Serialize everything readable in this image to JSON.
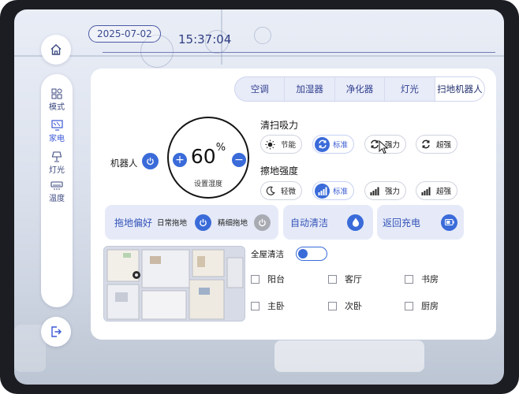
{
  "header": {
    "date": "2025-07-02",
    "time": "15:37:04"
  },
  "sidebar": {
    "home_icon": "home-icon",
    "items": [
      {
        "id": "mode",
        "label": "模式",
        "icon": "grid-icon",
        "active": false
      },
      {
        "id": "appliance",
        "label": "家电",
        "icon": "appliance-icon",
        "active": true
      },
      {
        "id": "light",
        "label": "灯光",
        "icon": "lamp-icon",
        "active": false
      },
      {
        "id": "temperature",
        "label": "温度",
        "icon": "ac-icon",
        "active": false
      }
    ],
    "logout_icon": "logout-icon"
  },
  "tabs": [
    {
      "label": "空调",
      "active": false
    },
    {
      "label": "加湿器",
      "active": false
    },
    {
      "label": "净化器",
      "active": false
    },
    {
      "label": "灯光",
      "active": false
    },
    {
      "label": "扫地机器人",
      "active": true
    }
  ],
  "robot": {
    "label": "机器人",
    "power_on": true
  },
  "dial": {
    "value": "60",
    "unit": "%",
    "label": "设置湿度"
  },
  "suction": {
    "title": "清扫吸力",
    "options": [
      {
        "label": "节能",
        "icon": "sun-icon",
        "active": false
      },
      {
        "label": "标准",
        "icon": "cycle-icon",
        "active": true
      },
      {
        "label": "强力",
        "icon": "cycle-icon",
        "active": false
      },
      {
        "label": "超强",
        "icon": "cycle-icon",
        "active": false
      }
    ]
  },
  "mop": {
    "title": "擦地强度",
    "options": [
      {
        "label": "轻微",
        "icon": "moon-icon",
        "active": false
      },
      {
        "label": "标准",
        "icon": "signal-bars-icon",
        "active": true
      },
      {
        "label": "强力",
        "icon": "signal-bars-icon",
        "active": false
      },
      {
        "label": "超强",
        "icon": "signal-bars-icon",
        "active": false
      }
    ]
  },
  "cards": {
    "mop_pref": {
      "title": "拖地偏好",
      "daily": "日常拖地",
      "fine": "精细拖地"
    },
    "auto_clean": {
      "title": "自动清洁"
    },
    "recharge": {
      "title": "返回充电"
    }
  },
  "whole_house": {
    "label": "全屋清洁",
    "on": true
  },
  "rooms": [
    {
      "label": "阳台",
      "checked": false
    },
    {
      "label": "客厅",
      "checked": false
    },
    {
      "label": "书房",
      "checked": false
    },
    {
      "label": "主卧",
      "checked": false
    },
    {
      "label": "次卧",
      "checked": false
    },
    {
      "label": "厨房",
      "checked": false
    }
  ],
  "colors": {
    "accent": "#3a6bd9",
    "accent_text": "#3353b8",
    "card_bg": "#e6eaf8",
    "frame": "#1c1d22"
  }
}
